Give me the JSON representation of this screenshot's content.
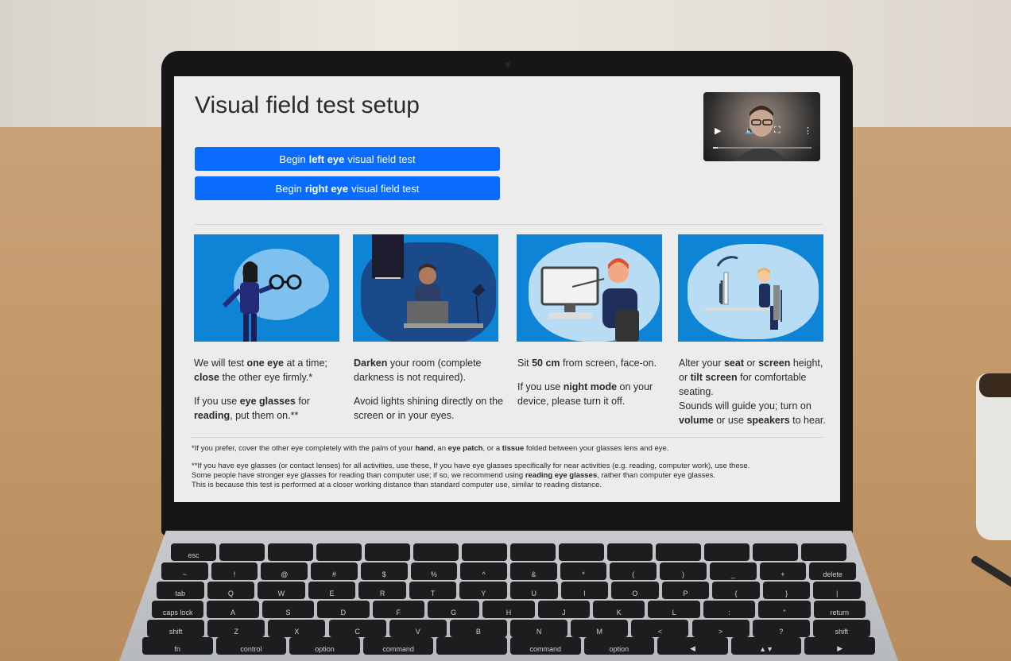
{
  "page": {
    "title": "Visual field test setup",
    "buttons": {
      "left_eye": {
        "prefix": "Begin",
        "bold": "left eye",
        "suffix": "visual field test"
      },
      "right_eye": {
        "prefix": "Begin",
        "bold": "right eye",
        "suffix": "visual field test"
      }
    },
    "video": {
      "controls": {
        "play": "▶",
        "volume": "🔊",
        "fullscreen": "⛶",
        "more": "⋮"
      },
      "progress": 0.05
    },
    "cards": [
      {
        "icon": "woman-glasses-illustration",
        "paragraphs": [
          {
            "parts": [
              [
                "We will test ",
                false
              ],
              [
                "one eye",
                true
              ],
              [
                " at a time; ",
                false
              ],
              [
                "close",
                true
              ],
              [
                " the other eye firmly.*",
                false
              ]
            ]
          },
          {
            "parts": [
              [
                "If you use ",
                false
              ],
              [
                "eye glasses",
                true
              ],
              [
                " for ",
                false
              ],
              [
                "reading",
                true
              ],
              [
                ", put them on.**",
                false
              ]
            ]
          }
        ]
      },
      {
        "icon": "dark-room-illustration",
        "paragraphs": [
          {
            "parts": [
              [
                "Darken",
                true
              ],
              [
                " your room (complete darkness is not required).",
                false
              ]
            ]
          },
          {
            "parts": [
              [
                "Avoid lights shining directly on the screen or in your eyes.",
                false
              ]
            ]
          }
        ]
      },
      {
        "icon": "screen-distance-illustration",
        "paragraphs": [
          {
            "parts": [
              [
                "Sit ",
                false
              ],
              [
                "50 cm",
                true
              ],
              [
                " from screen, face-on.",
                false
              ]
            ]
          },
          {
            "parts": [
              [
                "If you use ",
                false
              ],
              [
                "night mode",
                true
              ],
              [
                " on your device, please turn it off.",
                false
              ]
            ]
          }
        ]
      },
      {
        "icon": "seat-height-illustration",
        "paragraphs": [
          {
            "parts": [
              [
                "Alter your ",
                false
              ],
              [
                "seat",
                true
              ],
              [
                " or ",
                false
              ],
              [
                "screen",
                true
              ],
              [
                " height, or ",
                false
              ],
              [
                "tilt screen",
                true
              ],
              [
                " for comfortable seating.",
                false
              ]
            ]
          },
          {
            "parts": [
              [
                "Sounds will guide you; turn on ",
                false
              ],
              [
                "volume",
                true
              ],
              [
                " or use ",
                false
              ],
              [
                "speakers",
                true
              ],
              [
                " to hear.",
                false
              ]
            ]
          }
        ]
      }
    ],
    "footnotes": [
      [
        [
          "*If you prefer, cover the other eye completely with the palm of your ",
          false
        ],
        [
          "hand",
          true
        ],
        [
          ", an ",
          false
        ],
        [
          "eye patch",
          true
        ],
        [
          ", or a ",
          false
        ],
        [
          "tissue",
          true
        ],
        [
          " folded between your glasses lens and eye.",
          false
        ]
      ],
      [
        [
          "**If you have eye glasses (or contact lenses) for all activities, use these, If you have eye glasses specifically for near activities (e.g. reading, computer work), use these.",
          false
        ]
      ],
      [
        [
          "Some people have stronger eye glasses for reading than computer use; if so, we recommend using ",
          false
        ],
        [
          "reading eye glasses",
          true
        ],
        [
          ", rather than computer eye glasses.",
          false
        ]
      ],
      [
        [
          "This is because this test is performed at a closer working distance than standard computer use, similar to reading distance.",
          false
        ]
      ]
    ]
  },
  "keyboard": {
    "rows": [
      [
        "esc",
        "",
        "",
        "",
        "",
        "",
        "",
        "",
        "",
        "",
        "",
        "",
        "",
        ""
      ],
      [
        "~",
        "!",
        "@",
        "#",
        "$",
        "%",
        "^",
        "&",
        "*",
        "(",
        ")",
        "_",
        "+",
        "delete"
      ],
      [
        "tab",
        "Q",
        "W",
        "E",
        "R",
        "T",
        "Y",
        "U",
        "I",
        "O",
        "P",
        "{",
        "}",
        "|"
      ],
      [
        "caps lock",
        "A",
        "S",
        "D",
        "F",
        "G",
        "H",
        "J",
        "K",
        "L",
        ":",
        "\"",
        "return"
      ],
      [
        "shift",
        "Z",
        "X",
        "C",
        "V",
        "B",
        "N",
        "M",
        "<",
        ">",
        "?",
        "shift"
      ],
      [
        "fn",
        "control",
        "option",
        "command",
        "",
        "command",
        "option",
        "◀",
        "▲▼",
        "▶"
      ]
    ]
  }
}
